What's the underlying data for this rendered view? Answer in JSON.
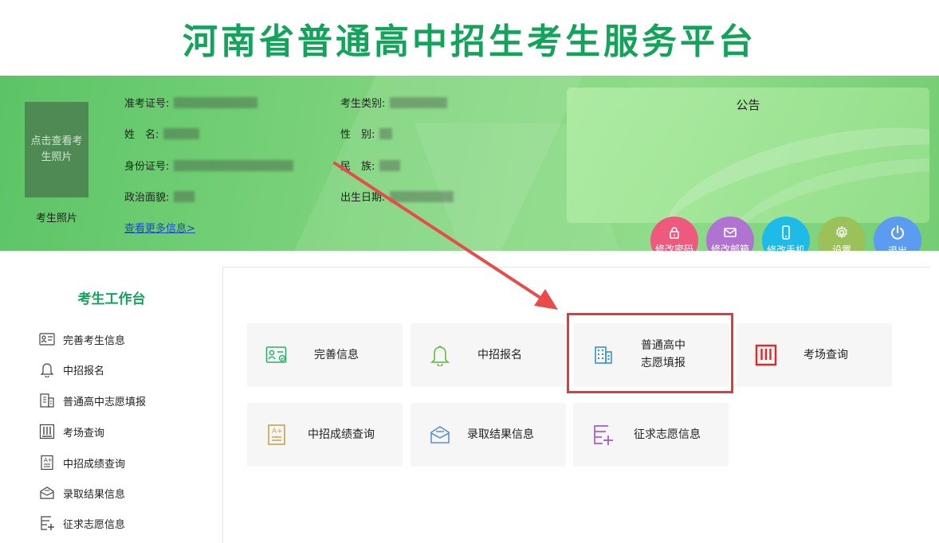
{
  "header": {
    "title": "河南省普通高中招生考生服务平台"
  },
  "profile": {
    "photo_placeholder": "点击查看考生照片",
    "photo_caption": "考生照片",
    "fields": {
      "exam_no_label": "准考证号:",
      "category_label": "考生类别:",
      "name_label": "姓　名:",
      "gender_label": "性　别:",
      "id_label": "身份证号:",
      "ethnicity_label": "民　族:",
      "political_label": "政治面貌:",
      "birth_label": "出生日期:"
    },
    "more_link": "查看更多信息>"
  },
  "notice": {
    "title": "公告"
  },
  "actions": [
    {
      "label": "修改密码",
      "icon": "lock-icon",
      "color": "#ee5a7e"
    },
    {
      "label": "修改邮箱",
      "icon": "mail-icon",
      "color": "#b073d1"
    },
    {
      "label": "修改手机",
      "icon": "phone-icon",
      "color": "#1fbbe8"
    },
    {
      "label": "设置",
      "icon": "gear-icon",
      "color": "#9bc25a"
    },
    {
      "label": "退出",
      "icon": "power-icon",
      "color": "#5b9cf2"
    }
  ],
  "sidebar": {
    "title": "考生工作台",
    "items": [
      {
        "label": "完善考生信息",
        "icon": "profile-card-icon"
      },
      {
        "label": "中招报名",
        "icon": "bell-icon"
      },
      {
        "label": "普通高中志愿填报",
        "icon": "building-icon"
      },
      {
        "label": "考场查询",
        "icon": "exam-room-icon"
      },
      {
        "label": "中招成绩查询",
        "icon": "score-sheet-icon"
      },
      {
        "label": "录取结果信息",
        "icon": "envelope-icon"
      },
      {
        "label": "征求志愿信息",
        "icon": "list-add-icon"
      }
    ]
  },
  "cards": [
    {
      "label": "完善信息",
      "icon": "profile-card-icon",
      "color": "#2fae6e"
    },
    {
      "label": "中招报名",
      "icon": "bell-icon",
      "color": "#6cc04a"
    },
    {
      "label_line1": "普通高中",
      "label_line2": "志愿填报",
      "icon": "building-icon",
      "color": "#3a8fd8"
    },
    {
      "label": "考场查询",
      "icon": "exam-room-icon",
      "color": "#e02828"
    },
    {
      "label": "中招成绩查询",
      "icon": "score-sheet-icon",
      "color": "#c9a24a"
    },
    {
      "label": "录取结果信息",
      "icon": "envelope-icon",
      "color": "#5b8fe0"
    },
    {
      "label": "征求志愿信息",
      "icon": "list-add-icon",
      "color": "#a85bc8"
    }
  ]
}
